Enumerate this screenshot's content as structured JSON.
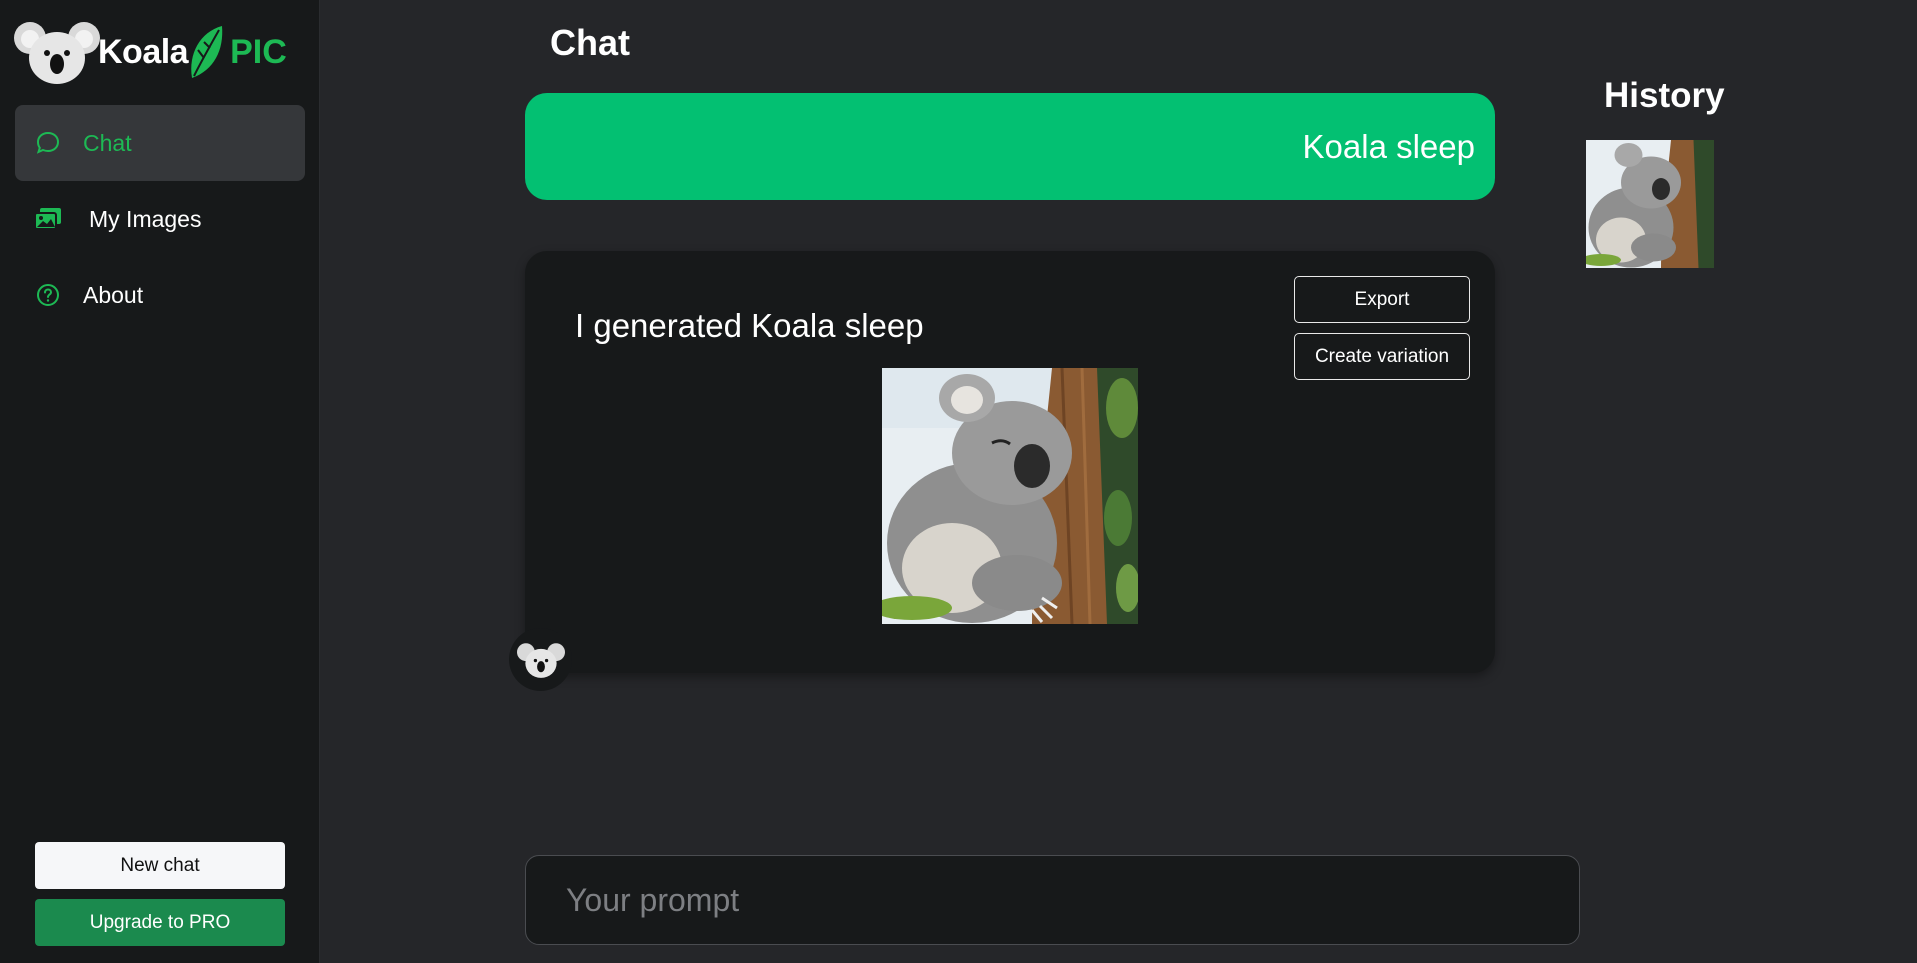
{
  "brand": {
    "name_part1": "Koala",
    "name_part2": "PIC",
    "accent": "#1db954"
  },
  "sidebar": {
    "items": [
      {
        "label": "Chat",
        "icon": "chat-bubble-icon",
        "active": true
      },
      {
        "label": "My Images",
        "icon": "images-icon",
        "active": false
      },
      {
        "label": "About",
        "icon": "question-circle-icon",
        "active": false
      }
    ],
    "new_chat_label": "New chat",
    "upgrade_label": "Upgrade to PRO"
  },
  "header": {
    "title": "Chat"
  },
  "chat": {
    "user_message": "Koala sleep",
    "bot_message": "I generated Koala sleep",
    "export_label": "Export",
    "variation_label": "Create variation",
    "user_bubble_color": "#03c072"
  },
  "history": {
    "title": "History"
  },
  "prompt": {
    "placeholder": "Your prompt",
    "value": ""
  }
}
